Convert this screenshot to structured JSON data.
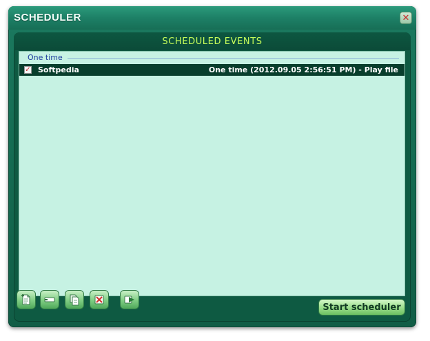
{
  "window": {
    "title": "SCHEDULER"
  },
  "panel": {
    "header": "SCHEDULED EVENTS"
  },
  "groups": [
    {
      "label": "One time",
      "events": [
        {
          "checked": true,
          "name": "Softpedia",
          "detail": "One time (2012.09.05 2:56:51 PM) - Play file"
        }
      ]
    }
  ],
  "toolbar": {
    "buttons": [
      {
        "icon": "add-event-icon"
      },
      {
        "icon": "edit-event-icon"
      },
      {
        "icon": "copy-event-icon"
      },
      {
        "icon": "delete-event-icon"
      },
      {
        "icon": "play-event-icon"
      }
    ],
    "start_label": "Start scheduler"
  },
  "colors": {
    "window_green": "#156d53",
    "panel_dark": "#0e5a42",
    "header_text": "#c9ff5a",
    "list_bg": "#c6f2e3",
    "selected_row": "#083e2c",
    "group_text": "#1f3d9e"
  }
}
